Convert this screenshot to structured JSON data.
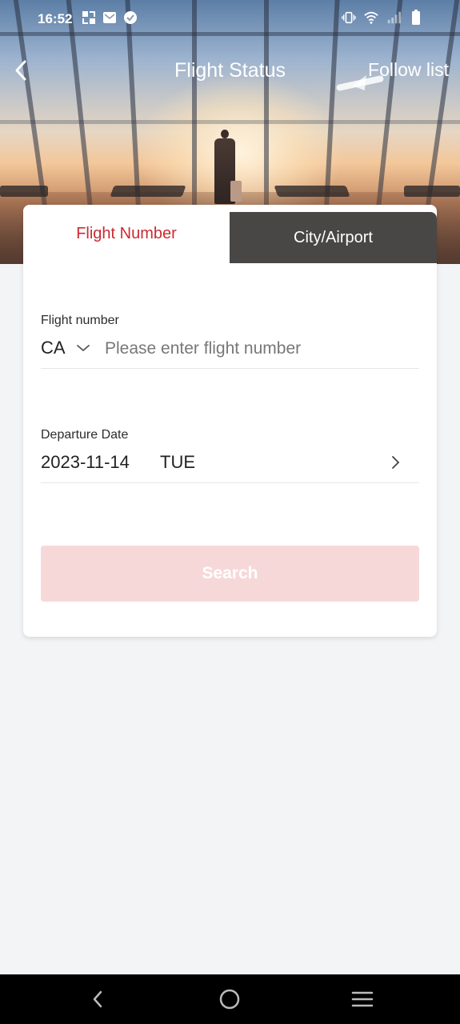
{
  "status_bar": {
    "time": "16:52",
    "left_icons": [
      "app-switch-icon",
      "mail-icon",
      "check-circle-icon"
    ],
    "right_icons": [
      "vibrate-icon",
      "wifi-icon",
      "signal-icon",
      "battery-icon"
    ]
  },
  "header": {
    "title": "Flight Status",
    "follow_label": "Follow list",
    "back_icon": "chevron-left-icon"
  },
  "tabs": [
    {
      "label": "Flight Number",
      "active": true
    },
    {
      "label": "City/Airport",
      "active": false
    }
  ],
  "form": {
    "flight_label": "Flight number",
    "carrier_code": "CA",
    "flight_placeholder": "Please enter flight number",
    "flight_value": "",
    "date_label": "Departure Date",
    "date_value": "2023-11-14",
    "weekday": "TUE",
    "search_label": "Search"
  },
  "colors": {
    "accent": "#cc2a31",
    "search_disabled_bg": "#f7d8d9",
    "page_bg": "#f3f4f6"
  },
  "nav_bar": {
    "buttons": [
      "nav-back-icon",
      "nav-home-icon",
      "nav-menu-icon"
    ]
  }
}
